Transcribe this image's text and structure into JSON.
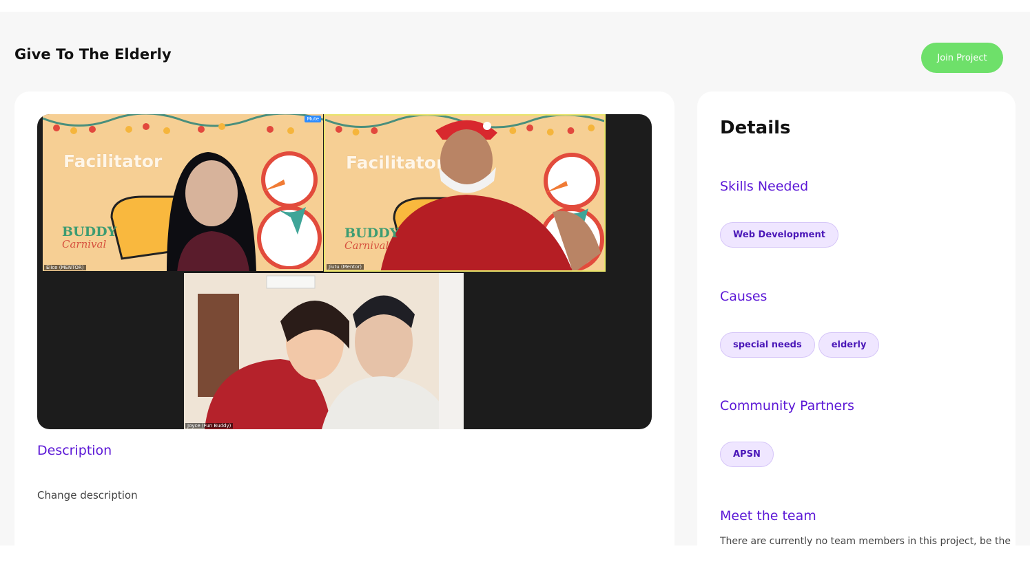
{
  "project": {
    "title": "Give To The Elderly",
    "join_label": "Join Project"
  },
  "video": {
    "tiles": [
      {
        "background_text": "Facilitator",
        "brand": "BUDDY",
        "brand_sub": "Carnival",
        "name_tag": "Elice (MENTOR)",
        "mute_label": "Mute"
      },
      {
        "background_text": "Facilitator",
        "brand": "BUDDY",
        "brand_sub": "Carnival",
        "name_tag": "Jiutu (Mentor)"
      },
      {
        "name_tag": "Joyce (Fun Buddy)"
      }
    ]
  },
  "description": {
    "heading": "Description",
    "text": "Change description"
  },
  "details": {
    "title": "Details",
    "skills": {
      "heading": "Skills Needed",
      "items": [
        "Web Development"
      ]
    },
    "causes": {
      "heading": "Causes",
      "items": [
        "special needs",
        "elderly"
      ]
    },
    "partners": {
      "heading": "Community Partners",
      "items": [
        "APSN"
      ]
    },
    "team": {
      "heading": "Meet the team",
      "text": "There are currently no team members in this project, be the"
    }
  },
  "colors": {
    "accent": "#5b17d6",
    "join_button": "#6ee06a",
    "chip_bg": "#efe6ff",
    "page_bg": "#f7f7f7"
  }
}
